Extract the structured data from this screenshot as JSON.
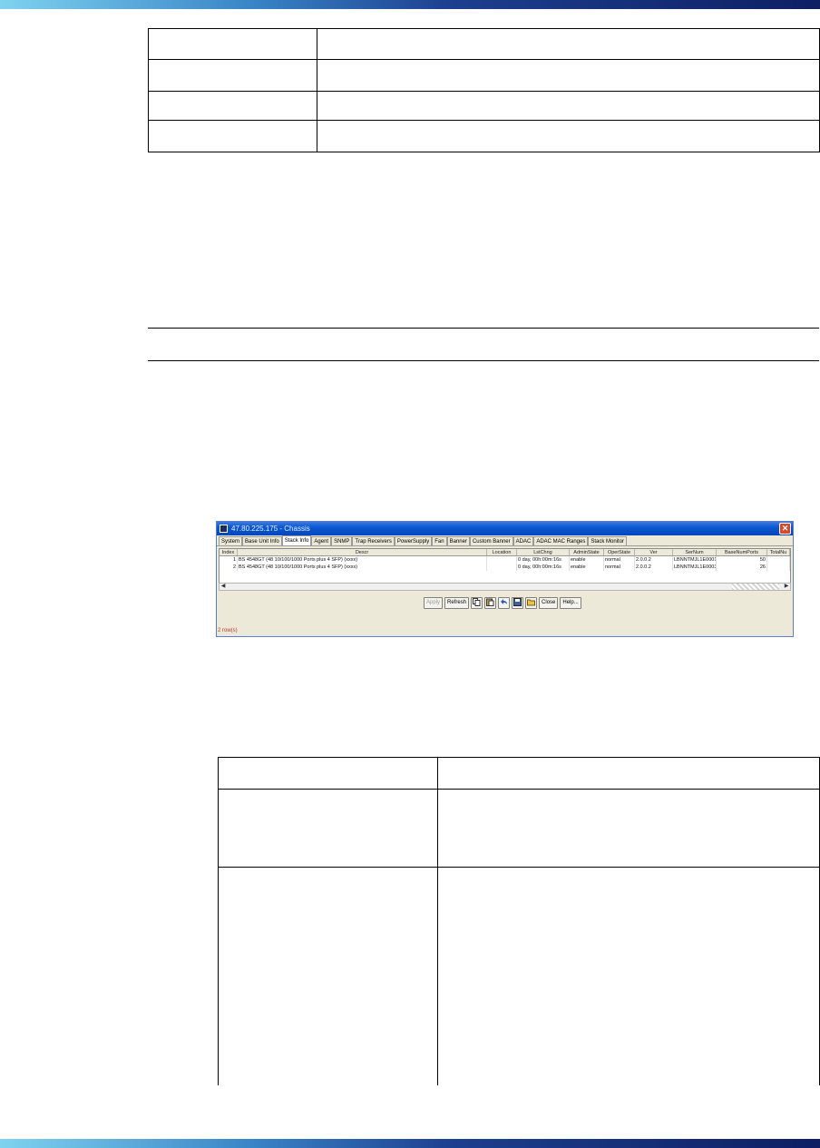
{
  "window": {
    "title": "47.80.225.175 - Chassis",
    "close_glyph": "✕",
    "tabs": [
      "System",
      "Base Unit Info",
      "Stack Info",
      "Agent",
      "SNMP",
      "Trap Receivers",
      "PowerSupply",
      "Fan",
      "Banner",
      "Custom Banner",
      "ADAC",
      "ADAC MAC Ranges",
      "Stack Monitor"
    ],
    "active_tab": "Stack Info",
    "grid": {
      "columns": [
        "Index",
        "Descr",
        "Location",
        "LstChng",
        "AdminState",
        "OperState",
        "Ver",
        "SerNum",
        "BaseNumPorts",
        "TotalNu"
      ],
      "rows": [
        [
          "1",
          "BS 4548GT (48 10/100/1000 Ports plus 4 SFP) (xxxx)",
          "",
          "0 day, 00h:00m:16s",
          "enable",
          "normal",
          "2.0.0.2",
          "LBNNTMJL1E0001",
          "50",
          ""
        ],
        [
          "2",
          "BS 4548GT (48 10/100/1000 Ports plus 4 SFP) (xxxx)",
          "",
          "0 day, 00h:00m:16s",
          "enable",
          "normal",
          "2.0.0.2",
          "LBNNTMJL1E0003",
          "26",
          ""
        ]
      ]
    },
    "scroll": {
      "left_arrow": "◀",
      "right_arrow": "▶"
    },
    "toolbar": {
      "apply": "Apply",
      "refresh": "Refresh",
      "close": "Close",
      "help": "Help..."
    },
    "status": "2 row(s)"
  }
}
